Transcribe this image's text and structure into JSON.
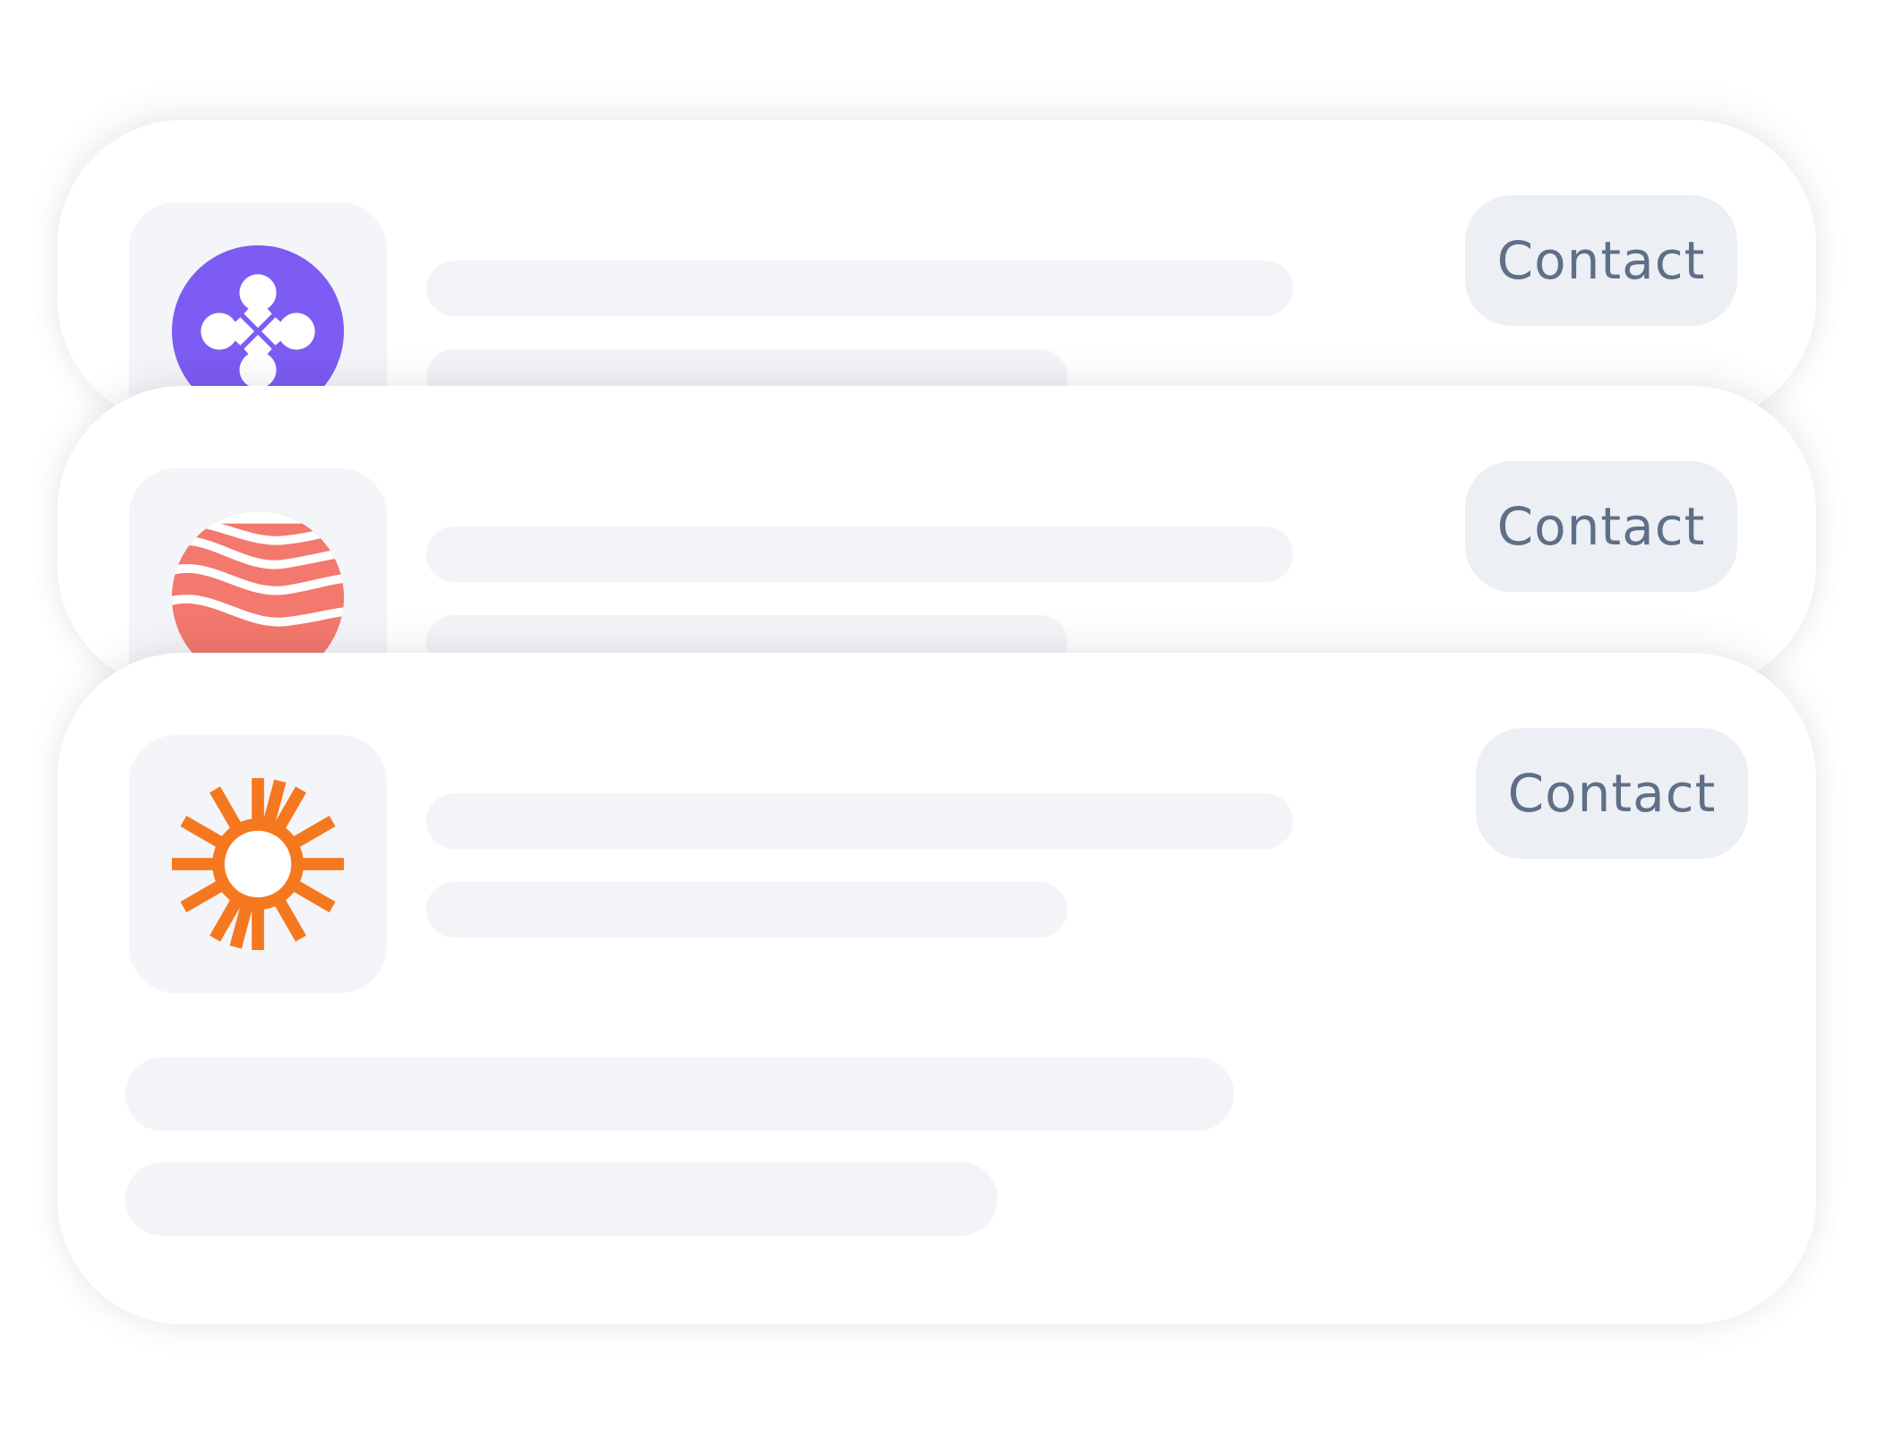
{
  "cards": [
    {
      "logo_icon": "clover-dots-icon",
      "logo_color": "#7c5cf2",
      "contact_label": "Contact"
    },
    {
      "logo_icon": "waves-sphere-icon",
      "logo_color": "#f3786d",
      "contact_label": "Contact"
    },
    {
      "logo_icon": "sunburst-icon",
      "logo_color": "#f5781f",
      "contact_label": "Contact"
    }
  ]
}
